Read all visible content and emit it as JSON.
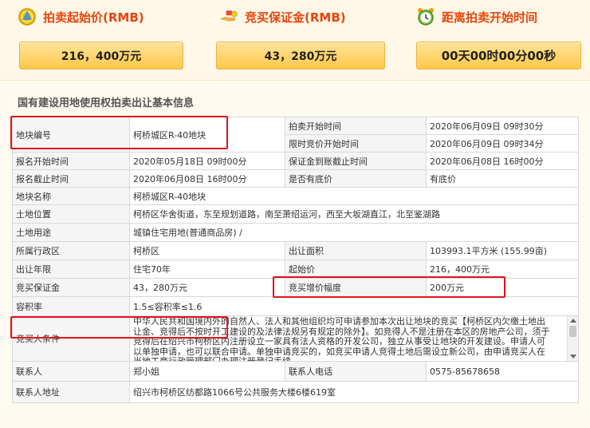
{
  "header": {
    "start_price": {
      "title": "拍卖起始价(RMB)",
      "value": "216，400万元",
      "icon": "gold-coin-icon"
    },
    "deposit": {
      "title": "竞买保证金(RMB)",
      "value": "43，280万元",
      "icon": "hand-money-icon"
    },
    "countdown": {
      "title": "距离拍卖开始时间",
      "value": "00天00时00分00秒",
      "icon": "alarm-clock-icon"
    }
  },
  "section_title": "国有建设用地使用权拍卖出让基本信息",
  "rows": {
    "plot_no": {
      "label": "地块编号",
      "value": "柯桥城区R-40地块"
    },
    "auction_start": {
      "label": "拍卖开始时间",
      "value": "2020年06月09日 09时30分"
    },
    "limited_start": {
      "label": "限时竞价开始时间",
      "value": "2020年06月09日 09时34分"
    },
    "reg_start": {
      "label": "报名开始时间",
      "value": "2020年05月18日 09时00分"
    },
    "deposit_deadline": {
      "label": "保证金到账截止时间",
      "value": "2020年06月08日 16时00分"
    },
    "reg_end": {
      "label": "报名截止时间",
      "value": "2020年06月08日 16时00分"
    },
    "reserve": {
      "label": "是否有底价",
      "value": "有底价"
    },
    "plot_name": {
      "label": "地块名称",
      "value": "柯桥城区R-40地块"
    },
    "location": {
      "label": "土地位置",
      "value": "柯桥区华舍街道，东至规划道路，南至萧绍运河，西至大坂湖直江，北至鉴湖路"
    },
    "usage": {
      "label": "土地用途",
      "value": "城镇住宅用地(普通商品房) /"
    },
    "district": {
      "label": "所属行政区",
      "value": "柯桥区"
    },
    "area": {
      "label": "出让面积",
      "value": "103993.1平方米 (155.99亩)"
    },
    "term": {
      "label": "出让年限",
      "value": "住宅70年"
    },
    "start_price": {
      "label": "起始价",
      "value": "216，400万元"
    },
    "deposit": {
      "label": "竞买保证金",
      "value": "43，280万元"
    },
    "increment": {
      "label": "竞买增价幅度",
      "value": "200万元"
    },
    "far": {
      "label": "容积率",
      "value": "1.5≤容积率≤1.6"
    },
    "buyer": {
      "label": "竞买人条件",
      "value": "中华人民共和国境内外的自然人、法人和其他组织均可申请参加本次出让地块的竞买【柯桥区内欠缴土地出让金、竞得后不按时开工建设的及法律法规另有规定的除外】。如竞得人不是注册在本区的房地产公司，须于竞得后在绍兴市柯桥区内注册设立一家具有法人资格的开发公司，独立从事受让地块的开发建设。申请人可以单独申请，也可以联合申请。单独申请竞买的，如竞买申请人竞得土地后需设立新公司，由申请竞买人在当地工商行政管理部门办理注册登记手续"
    },
    "contact": {
      "label": "联系人",
      "value": "郑小姐"
    },
    "phone": {
      "label": "联系人电话",
      "value": "0575-85678658"
    },
    "address": {
      "label": "联系人地址",
      "value": "绍兴市柯桥区纺都路1066号公共服务大楼6楼619室"
    }
  }
}
